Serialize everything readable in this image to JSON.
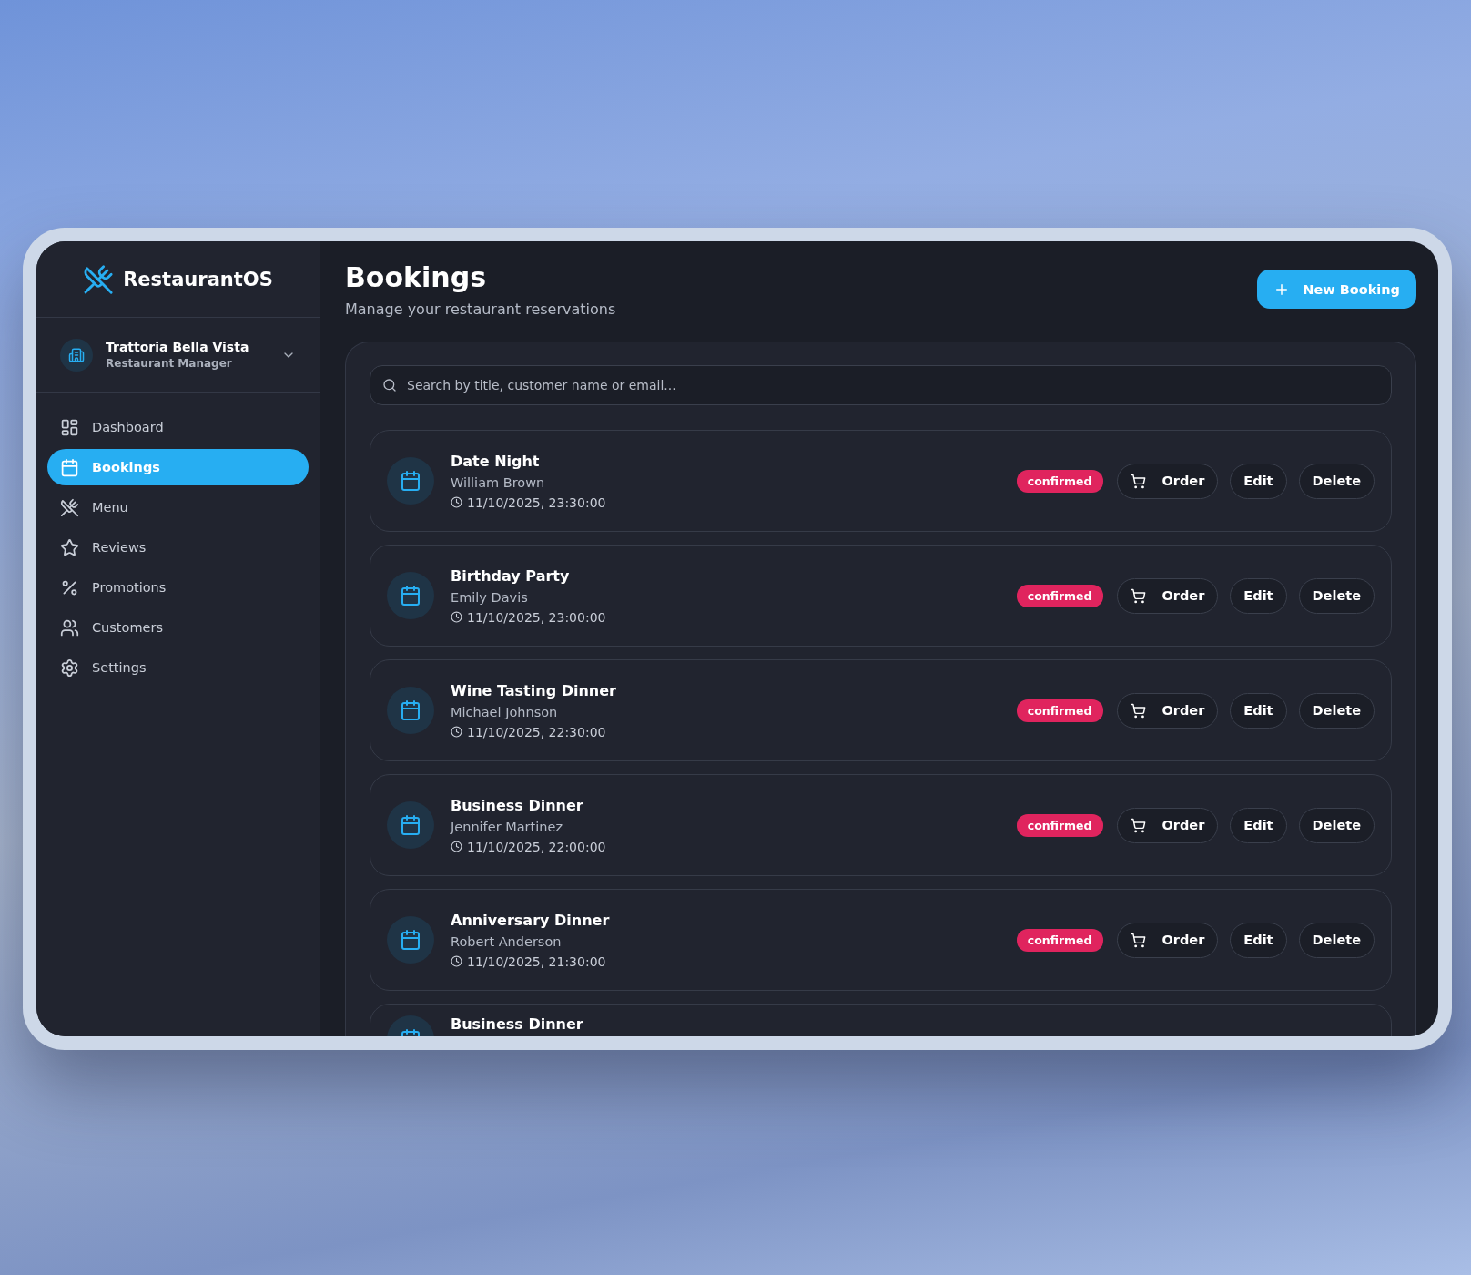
{
  "brand": {
    "name": "RestaurantOS"
  },
  "restaurant": {
    "name": "Trattoria Bella Vista",
    "role": "Restaurant Manager"
  },
  "nav": [
    {
      "label": "Dashboard",
      "selected": false
    },
    {
      "label": "Bookings",
      "selected": true
    },
    {
      "label": "Menu",
      "selected": false
    },
    {
      "label": "Reviews",
      "selected": false
    },
    {
      "label": "Promotions",
      "selected": false
    },
    {
      "label": "Customers",
      "selected": false
    },
    {
      "label": "Settings",
      "selected": false
    }
  ],
  "header": {
    "title": "Bookings",
    "subtitle": "Manage your restaurant reservations",
    "new_button": "New Booking"
  },
  "search": {
    "placeholder": "Search by title, customer name or email..."
  },
  "bookings": [
    {
      "title": "Date Night",
      "customer": "William Brown",
      "time": "11/10/2025, 23:30:00",
      "status": "confirmed",
      "actions": [
        {
          "label": "Order",
          "kind": "order"
        },
        {
          "label": "Edit",
          "kind": "plain"
        },
        {
          "label": "Delete",
          "kind": "plain"
        }
      ]
    },
    {
      "title": "Birthday Party",
      "customer": "Emily Davis",
      "time": "11/10/2025, 23:00:00",
      "status": "confirmed",
      "actions": [
        {
          "label": "Order",
          "kind": "order"
        },
        {
          "label": "Edit",
          "kind": "plain"
        },
        {
          "label": "Delete",
          "kind": "plain"
        }
      ]
    },
    {
      "title": "Wine Tasting Dinner",
      "customer": "Michael Johnson",
      "time": "11/10/2025, 22:30:00",
      "status": "confirmed",
      "actions": [
        {
          "label": "Order",
          "kind": "order"
        },
        {
          "label": "Edit",
          "kind": "plain"
        },
        {
          "label": "Delete",
          "kind": "plain"
        }
      ]
    },
    {
      "title": "Business Dinner",
      "customer": "Jennifer Martinez",
      "time": "11/10/2025, 22:00:00",
      "status": "confirmed",
      "actions": [
        {
          "label": "Order",
          "kind": "order"
        },
        {
          "label": "Edit",
          "kind": "plain"
        },
        {
          "label": "Delete",
          "kind": "plain"
        }
      ]
    },
    {
      "title": "Anniversary Dinner",
      "customer": "Robert Anderson",
      "time": "11/10/2025, 21:30:00",
      "status": "confirmed",
      "actions": [
        {
          "label": "Order",
          "kind": "order"
        },
        {
          "label": "Edit",
          "kind": "plain"
        },
        {
          "label": "Delete",
          "kind": "plain"
        }
      ]
    },
    {
      "title": "Business Dinner"
    }
  ]
}
